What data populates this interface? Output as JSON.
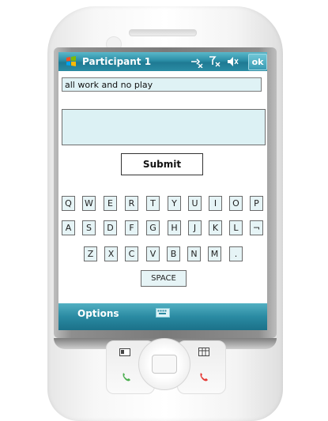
{
  "window": {
    "title": "Participant 1",
    "ok_label": "ok",
    "status_icons": [
      "connectivity-icon",
      "signal-off-icon",
      "volume-off-icon"
    ]
  },
  "prompt": {
    "text": "all work and no play"
  },
  "entry": {
    "value": ""
  },
  "submit_label": "Submit",
  "keyboard": {
    "row1": [
      "Q",
      "W",
      "E",
      "R",
      "T",
      "Y",
      "U",
      "I",
      "O",
      "P"
    ],
    "row2": [
      "A",
      "S",
      "D",
      "F",
      "G",
      "H",
      "J",
      "K",
      "L",
      "¬"
    ],
    "row3": [
      "Z",
      "X",
      "C",
      "V",
      "B",
      "N",
      "M",
      "."
    ],
    "space_label": "SPACE"
  },
  "menubar": {
    "left_label": "Options",
    "sip_icon": "keyboard-icon"
  },
  "hardware": {
    "left_softkey_icon": "contact-card-icon",
    "right_softkey_icon": "calendar-icon",
    "call_icon": "phone-call-icon",
    "end_icon": "phone-end-icon"
  },
  "colors": {
    "titlebar": "#2b8da6",
    "field_bg": "#dcf1f4",
    "key_bg": "#e6f4f6"
  }
}
